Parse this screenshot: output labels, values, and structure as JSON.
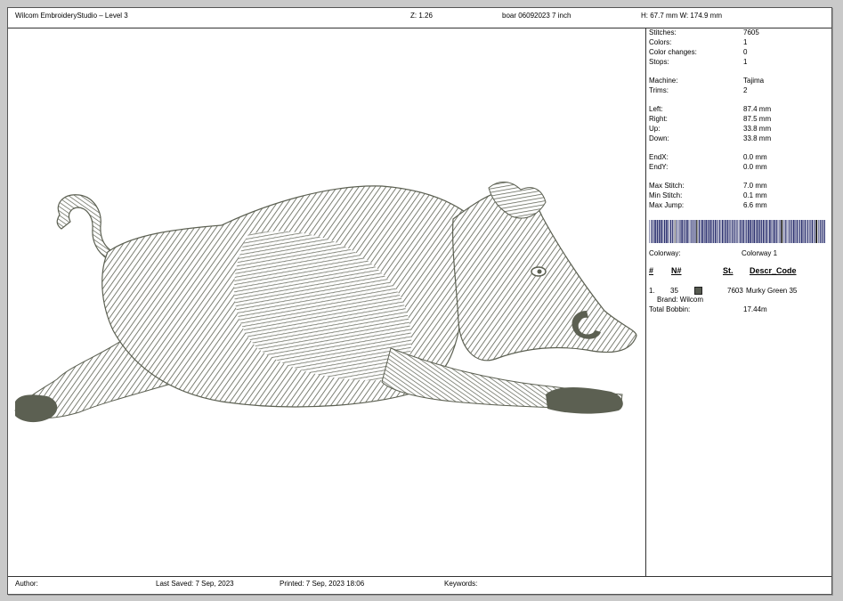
{
  "header": {
    "app_title": "Wilcom EmbroideryStudio – Level 3",
    "zoom": "Z: 1.26",
    "file_name": "boar 06092023 7  inch",
    "dimensions": "H: 67.7 mm   W: 174.9 mm"
  },
  "design": {
    "thread_color": "#5c6052"
  },
  "stats": {
    "stitches": {
      "label": "Stitches:",
      "value": "7605"
    },
    "colors": {
      "label": "Colors:",
      "value": "1"
    },
    "color_changes": {
      "label": "Color changes:",
      "value": "0"
    },
    "stops": {
      "label": "Stops:",
      "value": "1"
    },
    "machine": {
      "label": "Machine:",
      "value": "Tajima"
    },
    "trims": {
      "label": "Trims:",
      "value": "2"
    },
    "left": {
      "label": "Left:",
      "value": "87.4 mm"
    },
    "right": {
      "label": "Right:",
      "value": "87.5 mm"
    },
    "up": {
      "label": "Up:",
      "value": "33.8 mm"
    },
    "down": {
      "label": "Down:",
      "value": "33.8 mm"
    },
    "end_x": {
      "label": "EndX:",
      "value": "0.0 mm"
    },
    "end_y": {
      "label": "EndY:",
      "value": "0.0 mm"
    },
    "max_stitch": {
      "label": "Max Stitch:",
      "value": "7.0 mm"
    },
    "min_stitch": {
      "label": "Min Stitch:",
      "value": "0.1 mm"
    },
    "max_jump": {
      "label": "Max Jump:",
      "value": "6.6 mm"
    }
  },
  "colorway": {
    "label": "Colorway:",
    "value": "Colorway 1"
  },
  "thread_table": {
    "headers": {
      "num": "#",
      "n": "N#",
      "st": "St.",
      "descr": "Descr_Code"
    },
    "rows": [
      {
        "index": "1.",
        "code": "35",
        "swatch": "#565a50",
        "stitches": "7603",
        "description": "Murky Green 35"
      }
    ],
    "brand": "Brand: Wilcom",
    "total_bobbin_label": "Total Bobbin:",
    "total_bobbin_value": "17.44m"
  },
  "footer": {
    "author": "Author:",
    "last_saved": "Last Saved:  7 Sep, 2023",
    "printed": "Printed:  7 Sep, 2023 18:06",
    "keywords": "Keywords:"
  }
}
